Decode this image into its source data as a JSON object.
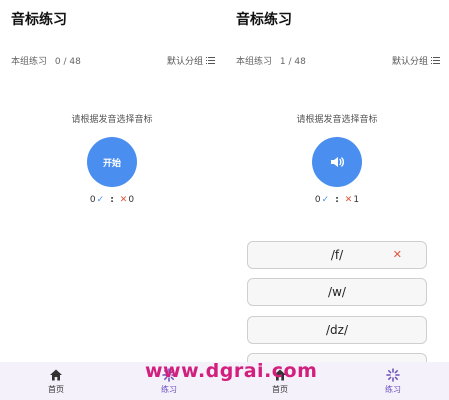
{
  "left_screen": {
    "title": "音标练习",
    "progress_label": "本组练习",
    "progress_value": "0 / 48",
    "group_label": "默认分组",
    "prompt": "请根据发音选择音标",
    "start_button": "开始",
    "correct_count": "0",
    "wrong_count": "0"
  },
  "right_screen": {
    "title": "音标练习",
    "progress_label": "本组练习",
    "progress_value": "1 / 48",
    "group_label": "默认分组",
    "prompt": "请根据发音选择音标",
    "play_icon": "speaker-icon",
    "correct_count": "0",
    "wrong_count": "1",
    "options": [
      {
        "label": "/f/",
        "marked_wrong": true
      },
      {
        "label": "/w/"
      },
      {
        "label": "/dz/"
      }
    ]
  },
  "bottom_nav": {
    "items": [
      {
        "label": "首页",
        "icon": "home-icon"
      },
      {
        "label": "练习",
        "icon": "practice-icon",
        "active": true
      },
      {
        "label": "首页",
        "icon": "home-icon"
      },
      {
        "label": "练习",
        "icon": "practice-icon",
        "active": true
      }
    ]
  },
  "watermark": "www.dgrai.com",
  "colors": {
    "accent": "#4a8ff0",
    "wrong": "#e0553b",
    "nav_active": "#6b4fbb",
    "watermark": "#d21e7c"
  }
}
